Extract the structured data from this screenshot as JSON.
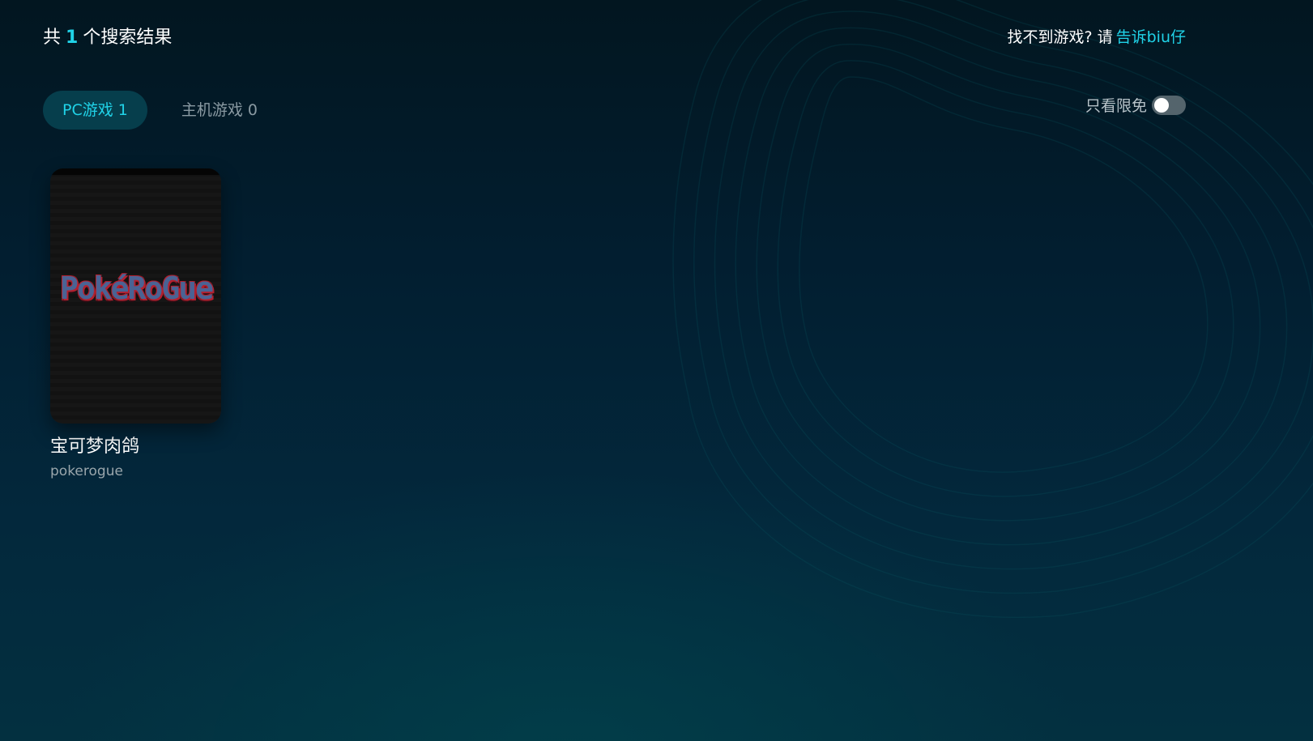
{
  "header": {
    "result_prefix": "共",
    "result_count": "1",
    "result_suffix": "个搜索结果",
    "help_text": "找不到游戏? 请",
    "help_link": "告诉biu仔"
  },
  "tabs": [
    {
      "label": "PC游戏",
      "count": "1",
      "active": true
    },
    {
      "label": "主机游戏",
      "count": "0",
      "active": false
    }
  ],
  "filter": {
    "label": "只看限免",
    "enabled": false
  },
  "games": [
    {
      "cover_logo_text": "PokéRoGue",
      "title": "宝可梦肉鸽",
      "subtitle": "pokerogue"
    }
  ],
  "colors": {
    "accent": "#20d3e8",
    "tab_active_bg": "#063e4c",
    "toggle_off": "#54646c",
    "logo_blue": "#4a6394",
    "logo_red": "#b3202f"
  },
  "icons": {
    "toggle": "toggle-switch-off-icon"
  }
}
